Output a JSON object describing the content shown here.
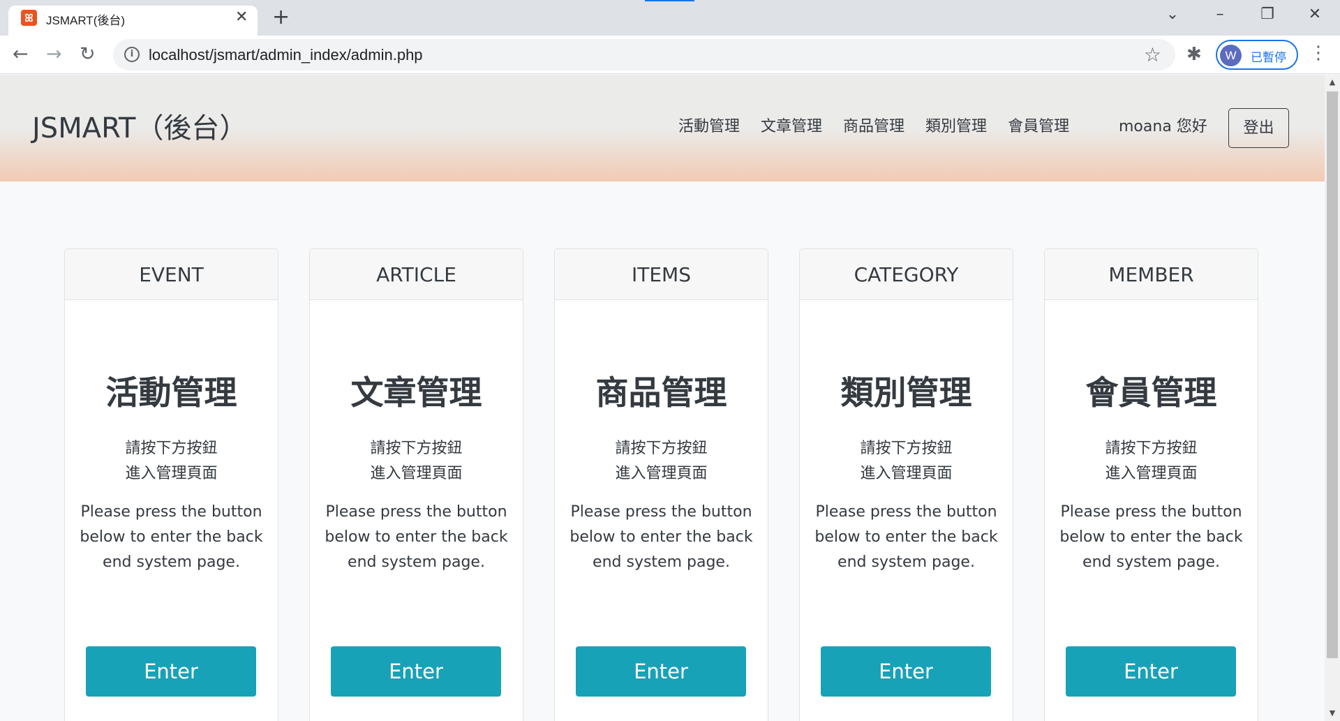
{
  "browser": {
    "tab_title": "JSMART(後台)",
    "favicon_glyph": "ꕤ",
    "url": "localhost/jsmart/admin_index/admin.php",
    "profile_initial": "W",
    "profile_status": "已暫停"
  },
  "header": {
    "brand": "JSMART（後台）",
    "nav": [
      "活動管理",
      "文章管理",
      "商品管理",
      "類別管理",
      "會員管理"
    ],
    "greeting": "moana 您好",
    "logout_label": "登出"
  },
  "cards": [
    {
      "header": "EVENT",
      "title": "活動管理",
      "cn_line1": "請按下方按鈕",
      "cn_line2": "進入管理頁面",
      "en_text": "Please press the button below to enter the back end system page.",
      "button": "Enter"
    },
    {
      "header": "ARTICLE",
      "title": "文章管理",
      "cn_line1": "請按下方按鈕",
      "cn_line2": "進入管理頁面",
      "en_text": "Please press the button below to enter the back end system page.",
      "button": "Enter"
    },
    {
      "header": "ITEMS",
      "title": "商品管理",
      "cn_line1": "請按下方按鈕",
      "cn_line2": "進入管理頁面",
      "en_text": "Please press the button below to enter the back end system page.",
      "button": "Enter"
    },
    {
      "header": "CATEGORY",
      "title": "類別管理",
      "cn_line1": "請按下方按鈕",
      "cn_line2": "進入管理頁面",
      "en_text": "Please press the button below to enter the back end system page.",
      "button": "Enter"
    },
    {
      "header": "MEMBER",
      "title": "會員管理",
      "cn_line1": "請按下方按鈕",
      "cn_line2": "進入管理頁面",
      "en_text": "Please press the button below to enter the back end system page.",
      "button": "Enter"
    }
  ],
  "colors": {
    "accent": "#17a2b8",
    "text": "#343a40",
    "header_gradient_bottom": "#f2cab3",
    "profile_blue": "#1a73e8"
  }
}
